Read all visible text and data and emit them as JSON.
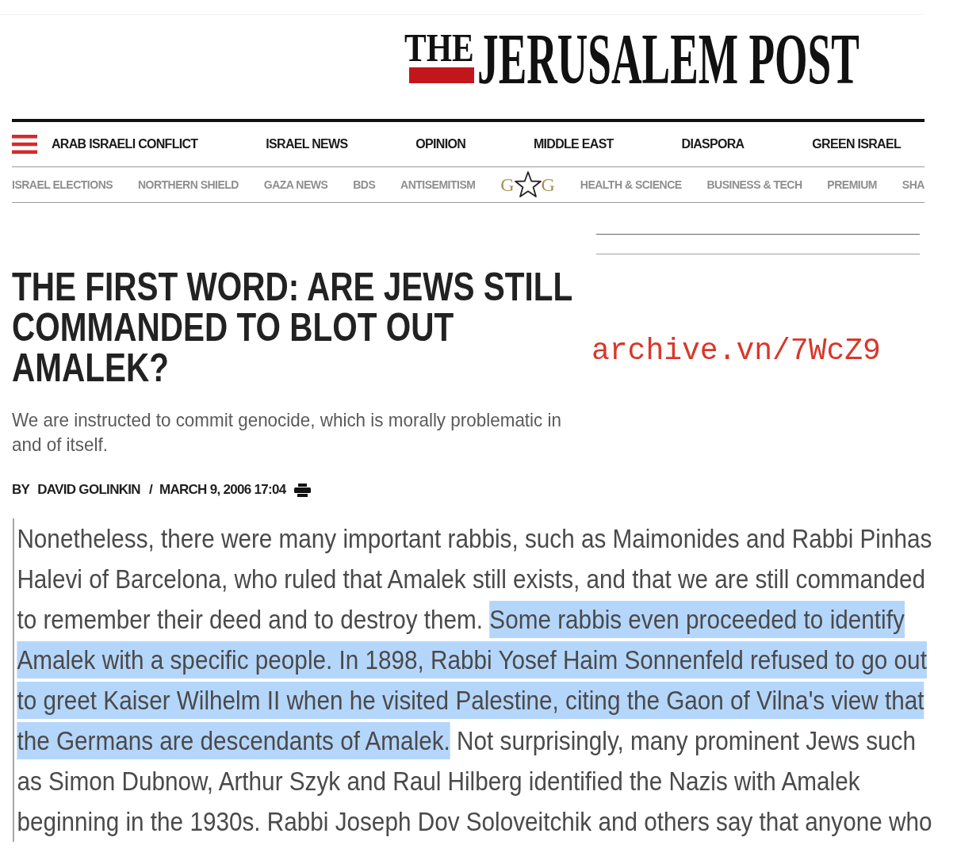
{
  "logo": {
    "small": "THE",
    "main": "JERUSALEM POST"
  },
  "main_nav": {
    "items": [
      "ARAB ISRAELI CONFLICT",
      "ISRAEL NEWS",
      "OPINION",
      "MIDDLE EAST",
      "DIASPORA",
      "GREEN ISRAEL"
    ]
  },
  "secondary_nav": {
    "items": [
      {
        "kind": "link",
        "label": "ISRAEL ELECTIONS"
      },
      {
        "kind": "link",
        "label": "NORTHERN SHIELD"
      },
      {
        "kind": "link",
        "label": "GAZA NEWS"
      },
      {
        "kind": "link",
        "label": "BDS"
      },
      {
        "kind": "link",
        "label": "ANTISEMITISM"
      },
      {
        "kind": "logo",
        "letters": [
          "G",
          "G"
        ]
      },
      {
        "kind": "link",
        "label": "HEALTH & SCIENCE"
      },
      {
        "kind": "link",
        "label": "BUSINESS & TECH"
      },
      {
        "kind": "link",
        "label": "PREMIUM"
      },
      {
        "kind": "link",
        "label": "SHA"
      }
    ]
  },
  "article": {
    "headline": "THE FIRST WORD: ARE JEWS STILL COMMANDED TO BLOT OUT AMALEK?",
    "subtitle_lines": [
      "We are instructed to commit genocide, which is morally problematic in",
      "and of itself."
    ],
    "byline": {
      "prefix": "BY",
      "author": "DAVID GOLINKIN",
      "separator": "/",
      "date": "MARCH 9, 2006 17:04"
    },
    "body_lines": [
      [
        {
          "text": "Nonetheless, there were many important rabbis, such as Maimonides and Rabbi Pinhas",
          "highlighted": false
        }
      ],
      [
        {
          "text": "Halevi of Barcelona, who ruled that Amalek still exists, and that we are still commanded",
          "highlighted": false
        }
      ],
      [
        {
          "text": "to remember their deed and to destroy them. ",
          "highlighted": false
        },
        {
          "text": "Some rabbis even proceeded to identify",
          "highlighted": true
        }
      ],
      [
        {
          "text": "Amalek with a specific people. In 1898, Rabbi Yosef Haim Sonnenfeld refused to go out",
          "highlighted": true
        }
      ],
      [
        {
          "text": "to greet Kaiser Wilhelm II when he visited Palestine, citing the Gaon of Vilna's view that",
          "highlighted": true
        }
      ],
      [
        {
          "text": "the Germans are descendants of Amalek.",
          "highlighted": true
        },
        {
          "text": " Not surprisingly, many prominent Jews such",
          "highlighted": false
        }
      ],
      [
        {
          "text": "as Simon Dubnow, Arthur Szyk and Raul Hilberg identified the Nazis with Amalek",
          "highlighted": false
        }
      ],
      [
        {
          "text": "beginning in the 1930s. Rabbi Joseph Dov Soloveitchik and others say that anyone who",
          "highlighted": false
        }
      ]
    ]
  },
  "annotation": {
    "text": "archive.vn/7WcZ9"
  }
}
